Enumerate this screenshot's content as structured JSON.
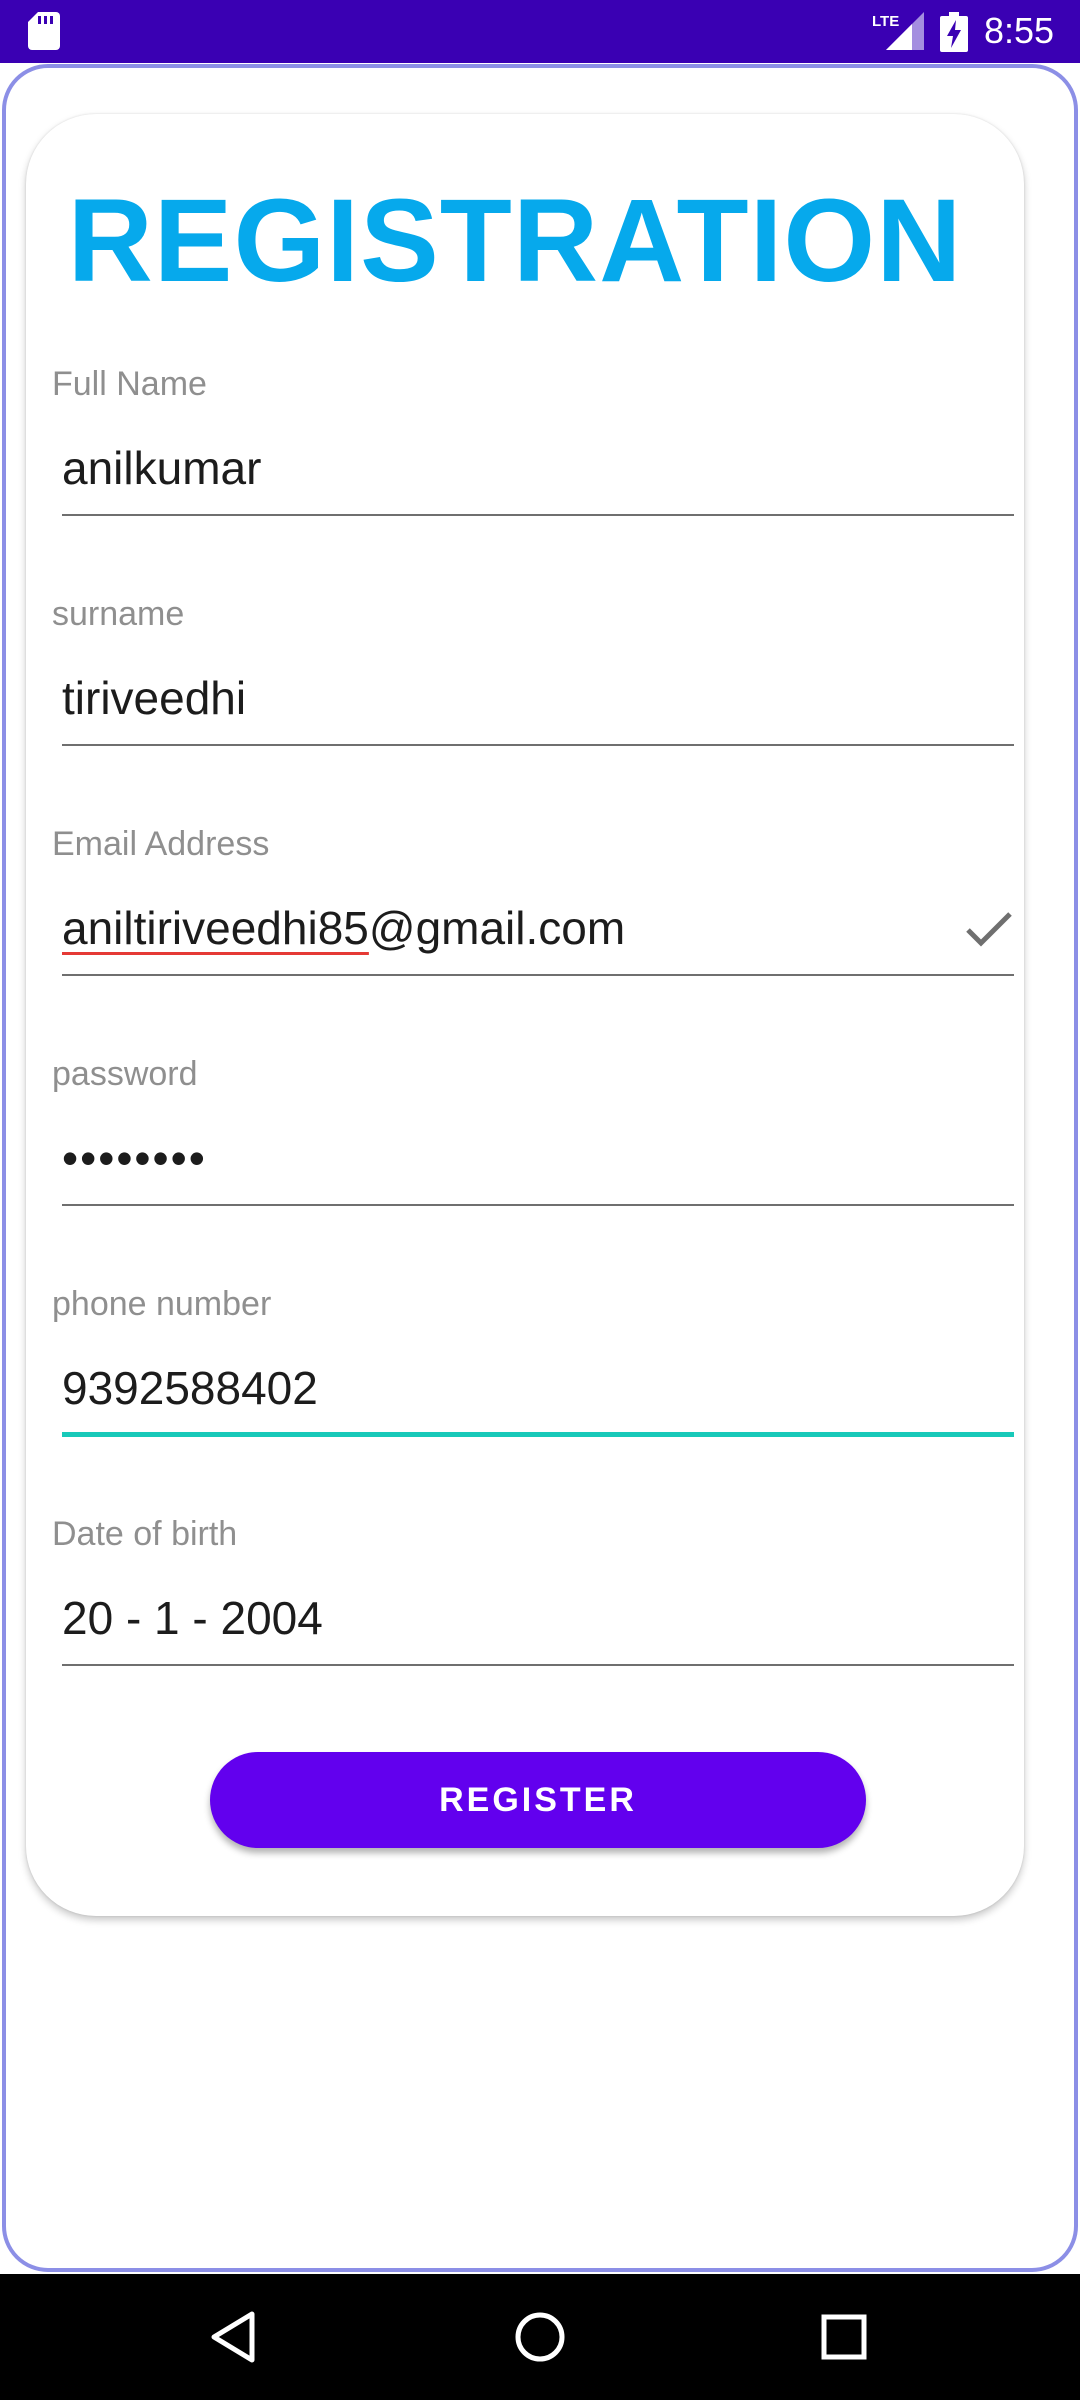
{
  "status_bar": {
    "time": "8:55",
    "network": "LTE",
    "icons": [
      "sd-card-icon",
      "lte-signal-icon",
      "battery-charging-icon"
    ],
    "background": "#3a00b3"
  },
  "form": {
    "title": "REGISTRATION",
    "title_color": "#06a9ec",
    "fields": [
      {
        "label": "Full Name",
        "value": "anilkumar"
      },
      {
        "label": "surname",
        "value": "tiriveedhi"
      },
      {
        "label": "Email Address",
        "value_misspelled": "aniltiriveedhi85",
        "value_rest": "@gmail.com",
        "valid": true
      },
      {
        "label": "password",
        "value": "••••••••"
      },
      {
        "label": "phone number",
        "value": "9392588402",
        "focused": true
      },
      {
        "label": "Date of birth",
        "value": "20 - 1 - 2004"
      }
    ],
    "submit_label": "REGISTER",
    "submit_color": "#6200ee",
    "focus_color": "#18c9b9"
  },
  "nav_bar": {
    "buttons": [
      "back-icon",
      "home-icon",
      "recents-icon"
    ]
  }
}
